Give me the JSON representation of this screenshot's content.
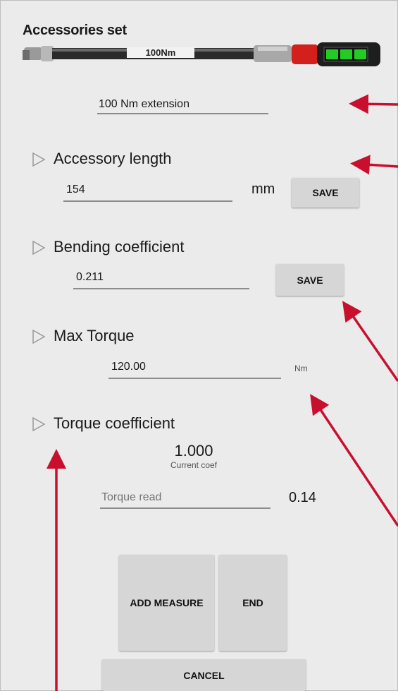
{
  "header": {
    "title": "Accessories set",
    "wrench_label": "100Nm"
  },
  "accessory": {
    "name": "100 Nm extension"
  },
  "length": {
    "label": "Accessory length",
    "value": "154",
    "unit": "mm",
    "save_label": "SAVE"
  },
  "bending": {
    "label": "Bending coefficient",
    "value": "0.211",
    "save_label": "SAVE"
  },
  "max_torque": {
    "label": "Max Torque",
    "value": "120.00",
    "unit": "Nm"
  },
  "torque_coef": {
    "label": "Torque coefficient",
    "current_value": "1.000",
    "current_caption": "Current coef",
    "read_placeholder": "Torque read",
    "read_value": "0.14"
  },
  "actions": {
    "add_measure": "ADD MEASURE",
    "end": "END",
    "cancel": "CANCEL"
  },
  "colors": {
    "background": "#ebebeb",
    "button": "#d6d6d6",
    "annotation_arrow": "#c8102e",
    "battery": "#22cc22",
    "wrench_cap": "#d4201a"
  }
}
